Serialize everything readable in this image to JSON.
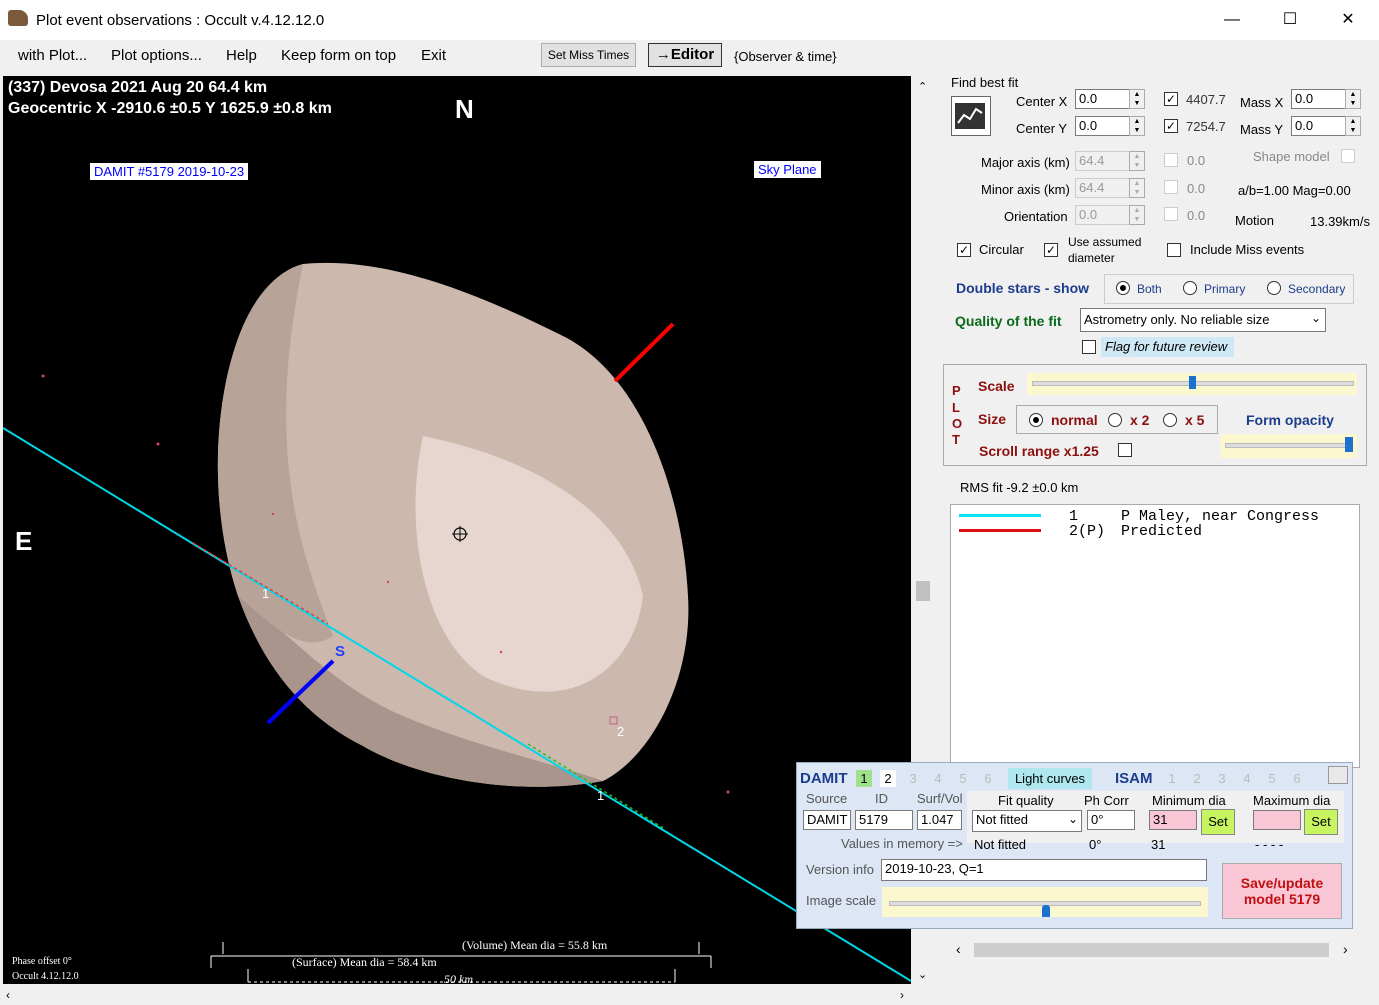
{
  "window": {
    "title": "Plot event observations : Occult v.4.12.12.0",
    "minimize": "—",
    "maximize": "☐",
    "close": "✕"
  },
  "menu": {
    "with_plot": "with Plot...",
    "plot_options": "Plot options...",
    "help": "Help",
    "keep_on_top": "Keep form on top",
    "exit": "Exit",
    "set_miss_times": "Set Miss Times",
    "editor": "→Editor",
    "observer_time": "{Observer & time}"
  },
  "plot": {
    "header1": "(337) Devosa  2021 Aug 20   64.4 km",
    "header2": "Geocentric  X  -2910.6 ±0.5  Y 1625.9 ±0.8 km",
    "north": "N",
    "east": "E",
    "damit_label": "DAMIT #5179 2019-10-23",
    "sky_plane": "Sky Plane",
    "south": "S",
    "chord1_label": "1",
    "chord2_label": "2",
    "chord1b_label": "1",
    "phase_offset": "Phase offset 0°",
    "version": "Occult 4.12.12.0",
    "volume_dia": "(Volume) Mean dia = 55.8 km",
    "surface_dia": "(Surface) Mean dia = 58.4 km",
    "scale_km": "50 km"
  },
  "fit": {
    "find_best_fit": "Find best fit",
    "center_x_label": "Center X",
    "center_x": "0.0",
    "center_y_label": "Center Y",
    "center_y": "0.0",
    "x_check_val": "4407.7",
    "mass_x_label": "Mass X",
    "mass_x": "0.0",
    "y_check_val": "7254.7",
    "mass_y_label": "Mass Y",
    "mass_y": "0.0",
    "major_label": "Major axis (km)",
    "major": "64.4",
    "major_chk": "0.0",
    "minor_label": "Minor axis (km)",
    "minor": "64.4",
    "minor_chk": "0.0",
    "orient_label": "Orientation",
    "orient": "0.0",
    "orient_chk": "0.0",
    "shape_model": "Shape model",
    "ab_mag": "a/b=1.00  Mag=0.00",
    "motion_label": "Motion",
    "motion": "13.39km/s",
    "circular": "Circular",
    "use_assumed": "Use assumed",
    "diameter": "diameter",
    "include_miss": "Include Miss events",
    "double_stars": "Double stars - show",
    "both": "Both",
    "primary": "Primary",
    "secondary": "Secondary",
    "quality_label": "Quality of the fit",
    "quality_value": "Astrometry only. No reliable size",
    "flag_review": "Flag for future review"
  },
  "plot_panel": {
    "p": "P",
    "l": "L",
    "o": "O",
    "t": "T",
    "scale": "Scale",
    "size": "Size",
    "normal": "normal",
    "x2": "x 2",
    "x5": "x 5",
    "form_opacity": "Form opacity",
    "scroll_range": "Scroll range x1.25"
  },
  "rms_fit": "RMS fit -9.2 ±0.0 km",
  "legend": [
    {
      "num": "1",
      "name": "P Maley, near Congress",
      "color": "#00e5f0"
    },
    {
      "num": "2(P)",
      "name": "Predicted",
      "color": "#e01010"
    }
  ],
  "damit": {
    "title": "DAMIT",
    "tabs": [
      "1",
      "2",
      "3",
      "4",
      "5",
      "6"
    ],
    "light_curves": "Light curves",
    "isam": "ISAM",
    "isam_tabs": [
      "1",
      "2",
      "3",
      "4",
      "5",
      "6"
    ],
    "source_label": "Source",
    "id_label": "ID",
    "surfvol_label": "Surf/Vol",
    "fitq_label": "Fit quality",
    "phcorr_label": "Ph Corr",
    "mindia_label": "Minimum dia",
    "maxdia_label": "Maximum dia",
    "source": "DAMIT",
    "id": "5179",
    "surfvol": "1.047",
    "fitq": "Not fitted",
    "phcorr": "0°",
    "mindia": "31",
    "maxdia": "",
    "set": "Set",
    "values_mem": "Values in memory =>",
    "mem_fitq": "Not fitted",
    "mem_phcorr": "0°",
    "mem_min": "31",
    "mem_max": "- - - -",
    "version_label": "Version info",
    "version": "2019-10-23, Q=1",
    "image_scale": "Image scale",
    "save_btn": "Save/update model 5179"
  }
}
